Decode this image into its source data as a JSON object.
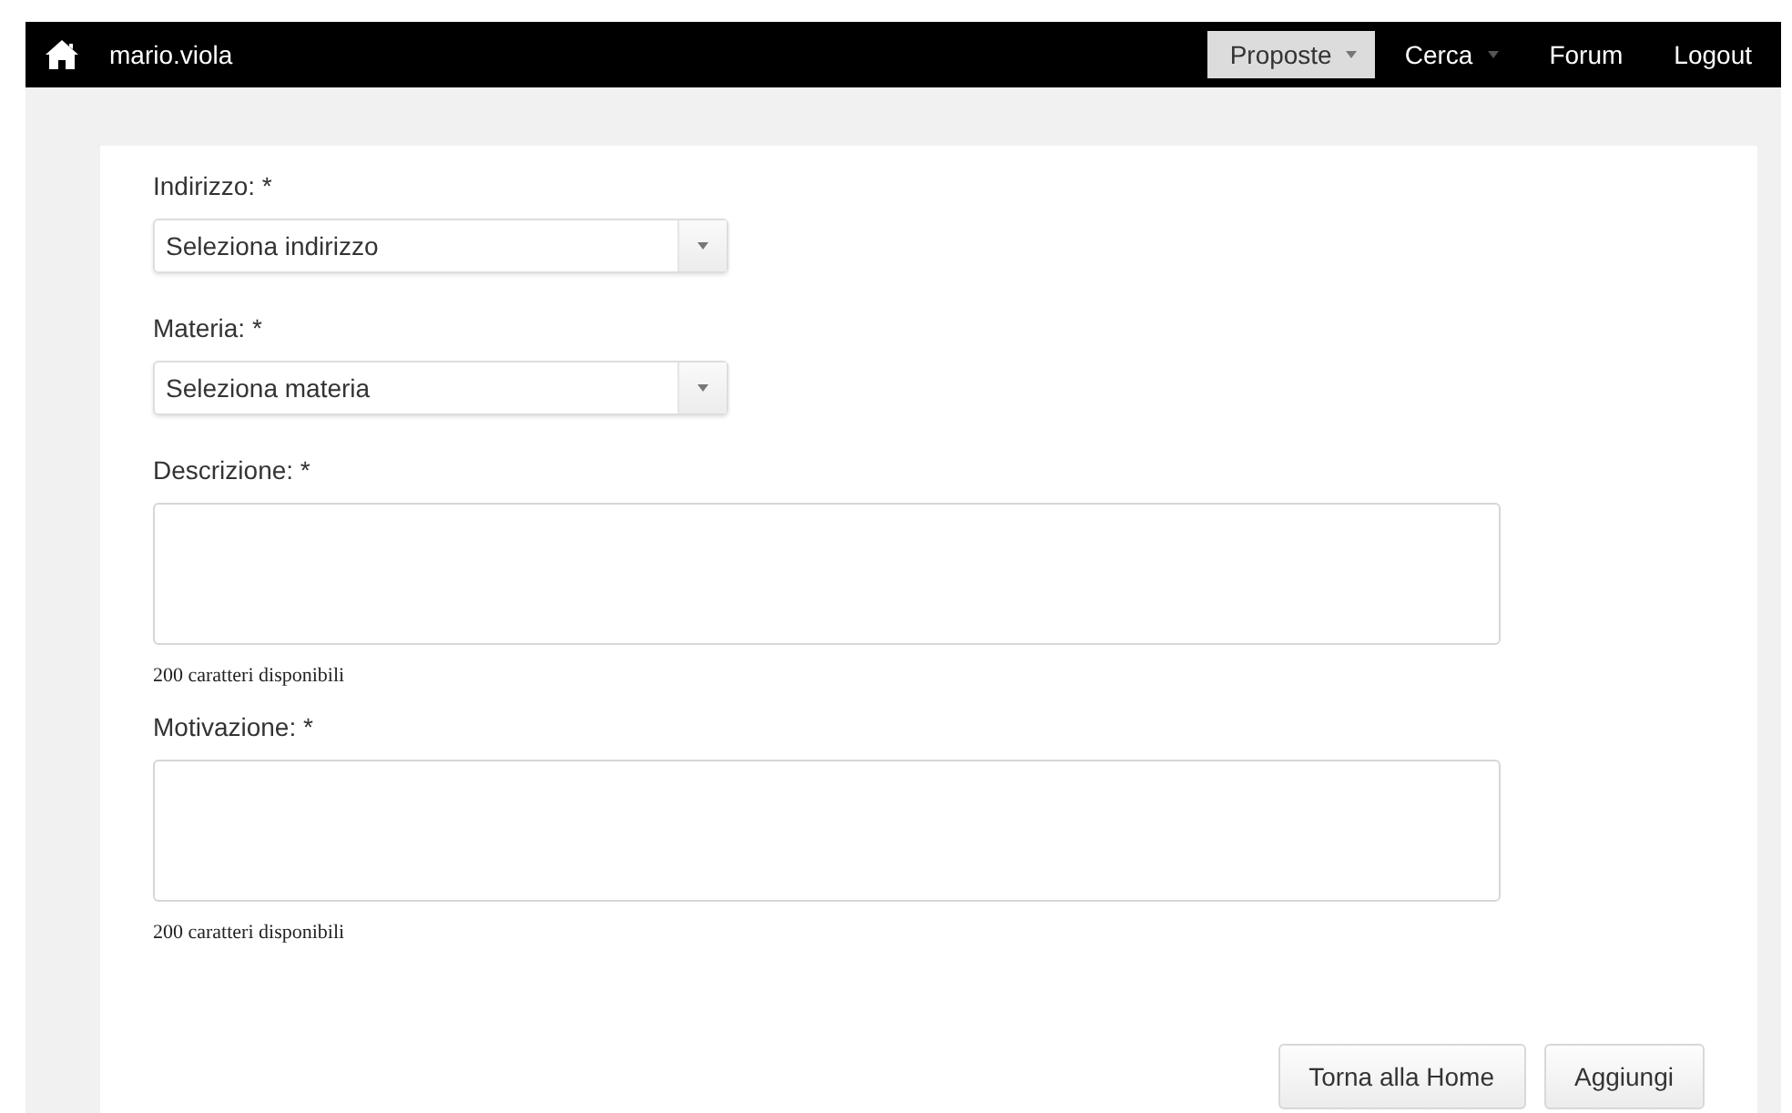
{
  "navbar": {
    "username": "mario.viola",
    "items": [
      {
        "label": "Proposte",
        "kind": "dropdown",
        "selected": true
      },
      {
        "label": "Cerca",
        "kind": "dropdown",
        "selected": false
      },
      {
        "label": "Forum",
        "kind": "link",
        "selected": false
      },
      {
        "label": "Logout",
        "kind": "link",
        "selected": false
      }
    ]
  },
  "form": {
    "fields": [
      {
        "label": "Indirizzo: *",
        "kind": "select",
        "value": "Seleziona indirizzo"
      },
      {
        "label": "Materia: *",
        "kind": "select",
        "value": "Seleziona materia"
      },
      {
        "label": "Descrizione: *",
        "kind": "textarea",
        "counter": "200 caratteri disponibili"
      },
      {
        "label": "Motivazione: *",
        "kind": "textarea",
        "counter": "200 caratteri disponibili"
      }
    ],
    "buttons": [
      "Torna alla Home",
      "Aggiungi"
    ]
  }
}
